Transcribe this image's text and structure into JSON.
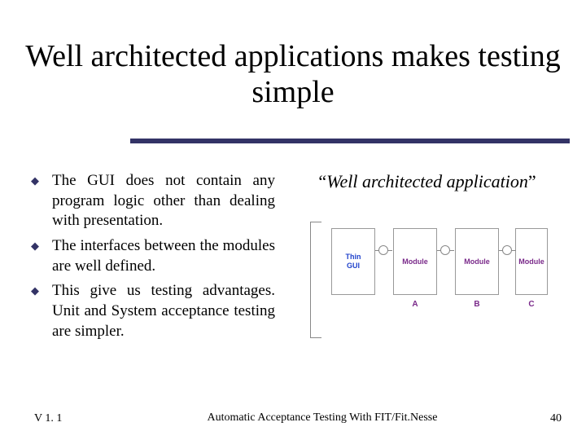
{
  "title": "Well architected applications makes testing simple",
  "bullets": [
    "The GUI does not contain any program logic other than dealing with presentation.",
    "The interfaces between the modules are well defined.",
    "This give us testing advantages. Unit and System acceptance testing are simpler."
  ],
  "diagram": {
    "caption_open": "“",
    "caption_text": "Well architected application",
    "caption_close": "”",
    "modules": {
      "thin": {
        "line1": "Thin",
        "line2": "GUI"
      },
      "a": {
        "label": "Module",
        "sub": "A"
      },
      "b": {
        "label": "Module",
        "sub": "B"
      },
      "c": {
        "label": "Module",
        "sub": "C"
      }
    }
  },
  "footer": {
    "version": "V 1. 1",
    "center": "Automatic Acceptance Testing With FIT/Fit.Nesse",
    "page": "40"
  }
}
